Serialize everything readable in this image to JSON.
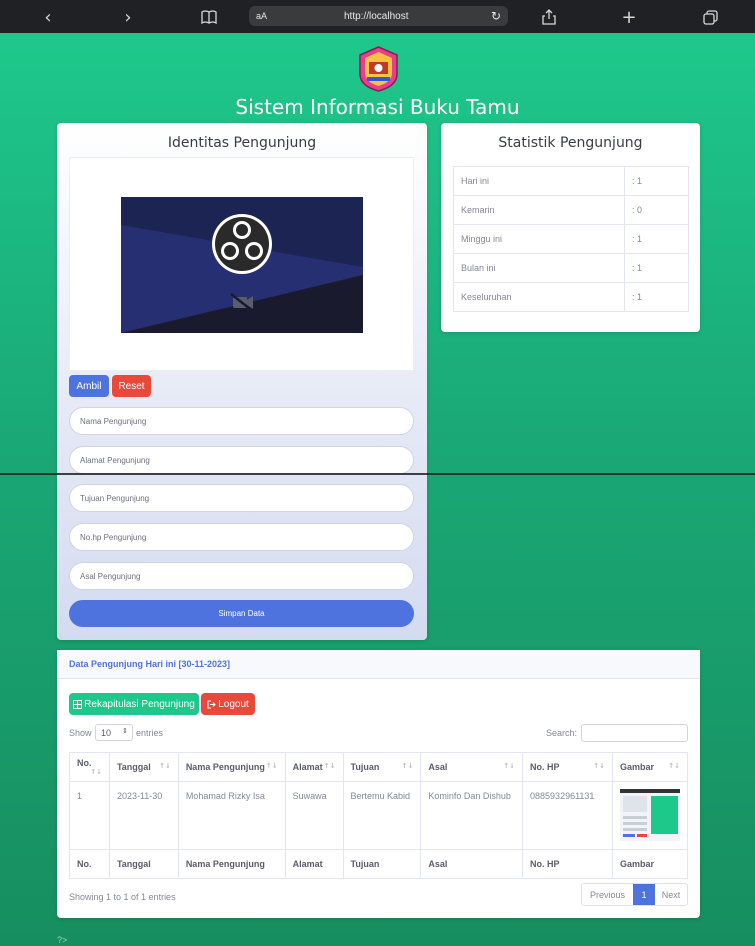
{
  "browser": {
    "text_size": "aA",
    "url": "http://localhost"
  },
  "site": {
    "title": "Sistem Informasi Buku Tamu"
  },
  "identity": {
    "title": "Identitas Pengunjung",
    "take_label": "Ambil",
    "reset_label": "Reset",
    "fields": {
      "name": "Nama Pengunjung",
      "address": "Alamat Pengunjung",
      "purpose": "Tujuan Pengunjung",
      "phone": "No.hp Pengunjung",
      "origin": "Asal Pengunjung"
    },
    "save_label": "Simpan Data"
  },
  "stats": {
    "title": "Statistik Pengunjung",
    "rows": [
      {
        "label": "Hari ini",
        "value": ": 1"
      },
      {
        "label": "Kemarin",
        "value": ": 0"
      },
      {
        "label": "Minggu ini",
        "value": ": 1"
      },
      {
        "label": "Bulan ini",
        "value": ": 1"
      },
      {
        "label": "Keseluruhan",
        "value": ": 1"
      }
    ]
  },
  "data": {
    "header": "Data Pengunjung Hari ini [30-11-2023]",
    "recap_label": "Rekapitulasi Pengunjung",
    "logout_label": "Logout",
    "show_label": "Show",
    "length_value": "10",
    "entries_label": "entries",
    "search_label": "Search:",
    "columns": [
      "No.",
      "Tanggal",
      "Nama Pengunjung",
      "Alamat",
      "Tujuan",
      "Asal",
      "No. HP",
      "Gambar"
    ],
    "rows": [
      {
        "no": "1",
        "date": "2023-11-30",
        "name": "Mohamad Rizky Isa",
        "address": "Suwawa",
        "purpose": "Bertemu Kabid",
        "origin": "Kominfo Dan Dishub",
        "phone": "0885932961131"
      }
    ],
    "info": "Showing 1 to 1 of 1 entries",
    "prev_label": "Previous",
    "page": "1",
    "next_label": "Next"
  },
  "footer": {
    "text": "?>"
  },
  "colors": {
    "primary": "#4e73df",
    "danger": "#e74a3b",
    "success": "#1cc88a"
  }
}
